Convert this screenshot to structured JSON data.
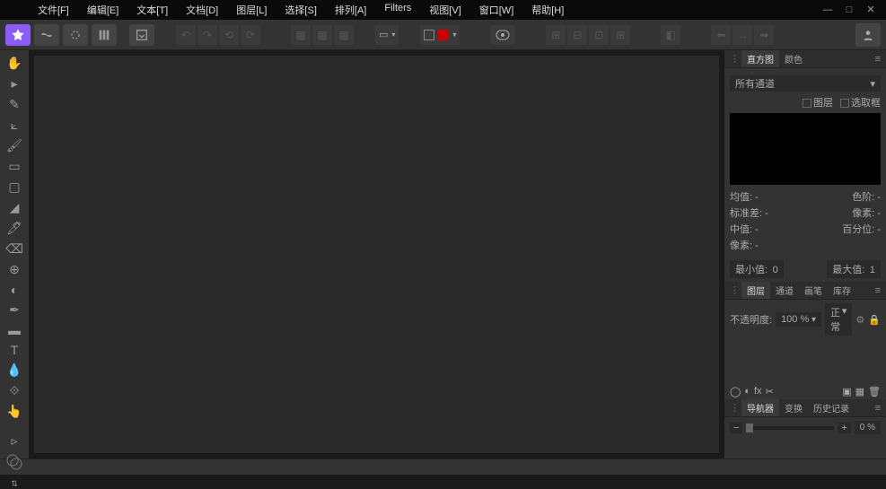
{
  "menu": {
    "file": "文件[F]",
    "edit": "编辑[E]",
    "text": "文本[T]",
    "doc": "文档[D]",
    "layer": "图层[L]",
    "select": "选择[S]",
    "arrange": "排列[A]",
    "filters": "Filters",
    "view": "视图[V]",
    "window": "窗口[W]",
    "help": "帮助[H]"
  },
  "histogram": {
    "tab_hist": "直方图",
    "tab_color": "颜色",
    "channel": "所有通道",
    "chk_layer": "图层",
    "chk_sel": "选取框",
    "mean_l": "均值:",
    "mean_v": "-",
    "hue_l": "色阶:",
    "hue_v": "-",
    "std_l": "标准差:",
    "std_v": "-",
    "px_l": "像素:",
    "px_v": "-",
    "med_l": "中值:",
    "med_v": "-",
    "pct_l": "百分位:",
    "pct_v": "-",
    "px2_l": "像素:",
    "px2_v": "-",
    "min_l": "最小值:",
    "min_v": "0",
    "max_l": "最大值:",
    "max_v": "1"
  },
  "layers": {
    "tab_layer": "图层",
    "tab_channel": "通道",
    "tab_brush": "画笔",
    "tab_stock": "库存",
    "opacity_l": "不透明度:",
    "opacity_v": "100 %",
    "blend": "正常"
  },
  "navigator": {
    "tab_nav": "导航器",
    "tab_trans": "变换",
    "tab_hist": "历史记录",
    "zoom": "0 %"
  }
}
